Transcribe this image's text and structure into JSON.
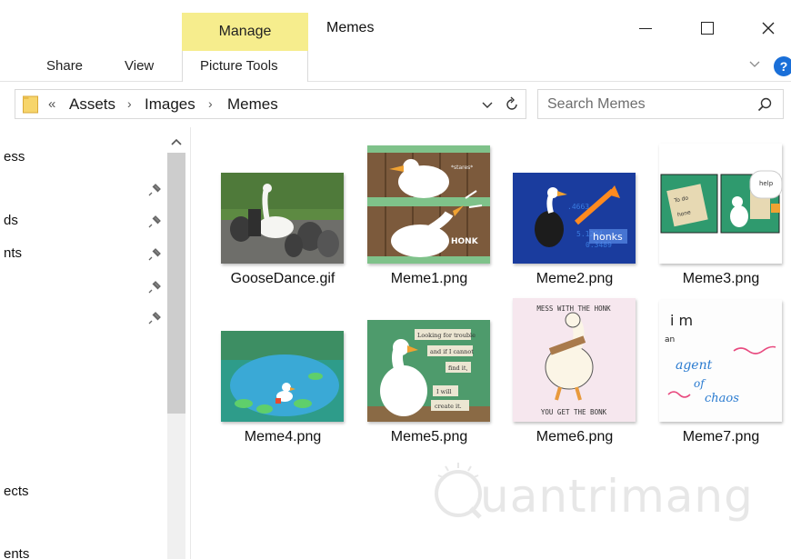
{
  "window": {
    "title": "Memes",
    "context_tab": "Manage"
  },
  "ribbon": {
    "tabs": [
      "Share",
      "View",
      "Picture Tools"
    ],
    "help_label": "?"
  },
  "address": {
    "overflow": "«",
    "crumbs": [
      "Assets",
      "Images",
      "Memes"
    ],
    "separator": "›"
  },
  "search": {
    "placeholder": "Search Memes"
  },
  "nav": {
    "items": [
      "ess",
      "ds",
      "nts",
      "ects",
      "ents"
    ]
  },
  "files": [
    {
      "name": "GooseDance.gif"
    },
    {
      "name": "Meme1.png",
      "caption_top": "*stares*",
      "caption_bottom": "HONK"
    },
    {
      "name": "Meme2.png",
      "caption": "honks"
    },
    {
      "name": "Meme3.png",
      "note_top": "To do",
      "note_bottom": "hone",
      "bubble": "help"
    },
    {
      "name": "Meme4.png"
    },
    {
      "name": "Meme5.png",
      "lines": [
        "Looking for trouble",
        "and if I cannot",
        "find it,",
        "I will",
        "create it."
      ]
    },
    {
      "name": "Meme6.png",
      "top_text": "MESS WITH THE HONK",
      "bottom_text": "YOU GET THE BONK"
    },
    {
      "name": "Meme7.png",
      "lines": [
        "i m",
        "an",
        "agent",
        "of",
        "chaos"
      ]
    }
  ],
  "watermark": {
    "text": "uantrimang"
  },
  "colors": {
    "manage_tab": "#f6ed8d",
    "help_blue": "#1a6fd8",
    "folder_yellow": "#f7d56b"
  }
}
